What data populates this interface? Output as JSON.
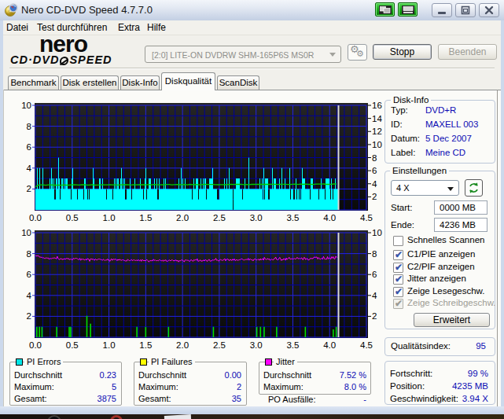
{
  "window": {
    "title": "Nero CD-DVD Speed 4.7.7.0",
    "app_icon": "gold-cd-with-gauge"
  },
  "menu": {
    "items": [
      "Datei",
      "Test durchführen",
      "Extra",
      "Hilfe"
    ]
  },
  "toolbar": {
    "logo_line1": "nero",
    "logo_line2_left": "CD·DVD",
    "logo_line2_right": "SPEED",
    "drive_select_value": "[2:0]   LITE-ON DVDRW SHM-165P6S MS0R",
    "eject_icon": "gears-icon",
    "stop_label": "Stopp",
    "exit_label": "Beenden"
  },
  "tabs": [
    {
      "label": "Benchmark",
      "active": false
    },
    {
      "label": "Disk erstellen",
      "active": false
    },
    {
      "label": "Disk-Info",
      "active": false
    },
    {
      "label": "Diskqualität",
      "active": true
    },
    {
      "label": "ScanDisk",
      "active": false
    }
  ],
  "disk_info": {
    "title": "Disk-Info",
    "rows": [
      {
        "label": "Typ:",
        "value": "DVD+R"
      },
      {
        "label": "ID:",
        "value": "MAXELL 003"
      },
      {
        "label": "Datum:",
        "value": "5 Dec 2007"
      },
      {
        "label": "Label:",
        "value": "Meine CD"
      }
    ]
  },
  "settings": {
    "title": "Einstellungen",
    "speed_value": "4 X",
    "start_label": "Start:",
    "start_value": "0000 MB",
    "end_label": "Ende:",
    "end_value": "4236 MB",
    "checkboxes": [
      {
        "label": "Schnelles Scannen",
        "checked": false,
        "disabled": false
      },
      {
        "label": "C1/PIE anzeigen",
        "checked": true,
        "disabled": false
      },
      {
        "label": "C2/PIF anzeigen",
        "checked": true,
        "disabled": false
      },
      {
        "label": "Jitter anzeigen",
        "checked": true,
        "disabled": false
      },
      {
        "label": "Zeige Lesegeschw.",
        "checked": true,
        "disabled": false
      },
      {
        "label": "Zeige Schreibgeschw.",
        "checked": true,
        "disabled": true
      }
    ],
    "advanced_label": "Erweitert"
  },
  "quality": {
    "label": "Qualitätsindex:",
    "value": "95"
  },
  "progress": {
    "rows": [
      {
        "label": "Fortschritt:",
        "value": "99 %"
      },
      {
        "label": "Position:",
        "value": "4235 MB"
      },
      {
        "label": "Geschwindigkeit:",
        "value": "3.94 X"
      }
    ]
  },
  "stats": {
    "pi_errors": {
      "title": "PI Errors",
      "legend_color": "#00e6e6",
      "rows": [
        {
          "label": "Durchschnitt",
          "value": "0.23"
        },
        {
          "label": "Maximum:",
          "value": "5"
        },
        {
          "label": "Gesamt:",
          "value": "3875"
        }
      ]
    },
    "pi_failures": {
      "title": "PI Failures",
      "legend_color": "#ffff00",
      "rows": [
        {
          "label": "Durchschnitt",
          "value": "0.00"
        },
        {
          "label": "Maximum:",
          "value": "2"
        },
        {
          "label": "Gesamt:",
          "value": "35"
        }
      ]
    },
    "jitter": {
      "title": "Jitter",
      "legend_color": "#ff00ff",
      "rows": [
        {
          "label": "Durchschnitt",
          "value": "7.52 %"
        },
        {
          "label": "Maximum:",
          "value": "8.0 %"
        }
      ]
    },
    "po_failures": {
      "label": "PO Ausfälle:",
      "value": "-"
    }
  },
  "chart_data": [
    {
      "type": "area",
      "title": "PI Errors histogram with read speed line",
      "xlim": [
        0,
        4.5
      ],
      "ylim_left": [
        0,
        10
      ],
      "ylim_right": [
        0,
        16
      ],
      "x_ticks": [
        "0.0",
        "0.5",
        "1.0",
        "1.5",
        "2.0",
        "2.5",
        "3.0",
        "3.5",
        "4.0",
        "4.5"
      ],
      "y_left_ticks": [
        10,
        8,
        6,
        4,
        2
      ],
      "y_right_ticks": [
        16,
        14,
        12,
        10,
        8,
        6,
        4,
        2
      ],
      "scan_end_gb": 4.105,
      "colors": {
        "area": "#00ffff",
        "speed_line": "#00cc00",
        "cursor": "#dadada",
        "grid_major": "#2323e4",
        "grid_minor": "#00009a"
      },
      "pi_error_columns": [
        2,
        2,
        4,
        2,
        2,
        4,
        2,
        2,
        2,
        4,
        2,
        2,
        2,
        2,
        2,
        2,
        2,
        2,
        3,
        2,
        4,
        3,
        2,
        3,
        1,
        1,
        3,
        3,
        2,
        5,
        3,
        1,
        2,
        3,
        3,
        2,
        3,
        2,
        3,
        3,
        3,
        2,
        2,
        2,
        2,
        1,
        3,
        4,
        2,
        2,
        2,
        2,
        2,
        1,
        2,
        2,
        2,
        2,
        2,
        2,
        2,
        1,
        3,
        3,
        2,
        2,
        1,
        2,
        1,
        2,
        2,
        2,
        2,
        4,
        3,
        2,
        2,
        2,
        2,
        2,
        2,
        3,
        3,
        2,
        2,
        3,
        2,
        2,
        2,
        2,
        1,
        2,
        2,
        2,
        2,
        2,
        2,
        2,
        1,
        2,
        3,
        2,
        3,
        2,
        3,
        3,
        2,
        2,
        3,
        4,
        2,
        3,
        2,
        3,
        1,
        1,
        2,
        2,
        2,
        2,
        3,
        2,
        1,
        2,
        2,
        2,
        3,
        2,
        2,
        2,
        2,
        2,
        2,
        3,
        2,
        2,
        2,
        1,
        2,
        3,
        4,
        1,
        2,
        2,
        3,
        3,
        3,
        2,
        2,
        2,
        2,
        3,
        2,
        2,
        3,
        1,
        1,
        3,
        2,
        2,
        2,
        2,
        2,
        3,
        2,
        3,
        2,
        2,
        2,
        2,
        2,
        2,
        2,
        2,
        2,
        2,
        2,
        2,
        2,
        2,
        2,
        2,
        3,
        2,
        2,
        4,
        2,
        3,
        2,
        2,
        3,
        2,
        2,
        2,
        2,
        2,
        2,
        2,
        2,
        1,
        2,
        3,
        2,
        2,
        3,
        3,
        3,
        1,
        2,
        2,
        3,
        2,
        2,
        3,
        2,
        3,
        3,
        1,
        2,
        2,
        2,
        3,
        3,
        3,
        3,
        4,
        2,
        2,
        2,
        2,
        2,
        1,
        1,
        1,
        2,
        2,
        2,
        2,
        2,
        2,
        3,
        2,
        2,
        3,
        2,
        2,
        4,
        2,
        2,
        2,
        2,
        0,
        2,
        2,
        2,
        3,
        3,
        3,
        3,
        3,
        2,
        2,
        2,
        1,
        2,
        2,
        3,
        2,
        2,
        2,
        2,
        5,
        2,
        2,
        2,
        2,
        2,
        2,
        2,
        2,
        2,
        2,
        2,
        2,
        2,
        3,
        2,
        2,
        3,
        1,
        4,
        1,
        3,
        3,
        3,
        3,
        1,
        1,
        2,
        2,
        2,
        4,
        2,
        3,
        3,
        3,
        2,
        2,
        2,
        2,
        3,
        2,
        2,
        4,
        2,
        2,
        2,
        3,
        2,
        2,
        2,
        2,
        2,
        4,
        1,
        2,
        2,
        2,
        1,
        1,
        2,
        3,
        1,
        2,
        2,
        1,
        2,
        1,
        2,
        4,
        3,
        3,
        3,
        2,
        2,
        2,
        2,
        2,
        2,
        1,
        3,
        3,
        3,
        2,
        2,
        2,
        2,
        2,
        2,
        2,
        1,
        2,
        2,
        3,
        2,
        2,
        2,
        2,
        1,
        3,
        3,
        3,
        3,
        3,
        2,
        1,
        3,
        2,
        1,
        2,
        2,
        3,
        2,
        2,
        2
      ],
      "speed_line": {
        "x0": 0,
        "dx": 0.035,
        "speed": [
          3.53,
          3.77,
          3.84,
          3.83,
          3.77,
          3.82,
          3.84,
          3.79,
          3.79,
          3.79,
          3.78,
          3.82,
          3.79,
          3.79,
          3.84,
          3.85,
          3.84,
          3.81,
          3.85,
          3.85,
          3.8,
          3.81,
          3.86,
          3.79,
          3.8,
          3.83,
          3.86,
          3.83,
          3.83,
          3.87,
          3.84,
          3.83,
          3.81,
          3.84,
          3.86,
          3.85,
          3.86,
          3.81,
          3.87,
          3.83,
          3.85,
          3.86,
          3.85,
          3.83,
          3.88,
          3.84,
          3.89,
          3.86,
          3.83,
          3.87,
          3.83,
          3.89,
          3.89,
          3.83,
          3.86,
          3.89,
          3.85,
          3.87,
          3.88,
          3.84,
          3.91,
          3.87,
          3.89,
          3.87,
          3.84,
          3.89,
          3.91,
          3.88,
          3.89,
          3.89,
          3.86,
          3.85,
          3.86,
          3.87,
          3.85,
          3.88,
          3.92,
          3.88,
          3.91,
          3.91,
          3.92,
          3.87,
          3.88,
          3.87,
          3.91,
          3.93,
          3.91,
          3.91,
          3.91,
          3.91,
          3.93,
          3.91,
          3.93,
          3.93,
          3.89,
          3.91,
          3.92,
          3.92,
          3.9,
          3.9,
          3.93,
          3.94,
          3.89,
          3.95,
          3.91,
          3.94,
          3.91,
          3.92,
          3.9,
          3.95,
          3.94,
          3.95,
          3.97,
          3.91,
          3.91,
          3.93,
          3.97,
          3.96
        ]
      }
    },
    {
      "type": "line+bar",
      "title": "Jitter line with PI Failures bars",
      "xlim": [
        0,
        4.5
      ],
      "ylim_left": [
        0,
        10
      ],
      "ylim_right": [
        0,
        10
      ],
      "x_ticks": [
        "0.0",
        "0.5",
        "1.0",
        "1.5",
        "2.0",
        "2.5",
        "3.0",
        "3.5",
        "4.0",
        "4.5"
      ],
      "y_left_ticks": [
        10,
        8,
        6,
        4,
        2
      ],
      "y_right_ticks": [
        10,
        8,
        6,
        4,
        2
      ],
      "scan_end_gb": 4.105,
      "colors": {
        "bars": "#00dc00",
        "jitter_line": "#ff00ff",
        "cursor": "#dadada",
        "grid_major": "#2323e4",
        "grid_minor": "#00009a"
      },
      "jitter_line": {
        "x0": 0,
        "dx": 0.011,
        "values": [
          7.8,
          7.8,
          7.75,
          7.82,
          7.79,
          7.67,
          7.67,
          7.64,
          7.66,
          7.58,
          7.61,
          7.56,
          7.52,
          7.61,
          7.57,
          7.57,
          7.59,
          7.44,
          7.54,
          7.53,
          7.52,
          7.59,
          7.51,
          7.62,
          7.57,
          7.56,
          7.5,
          7.74,
          7.56,
          7.46,
          7.43,
          7.51,
          7.53,
          7.42,
          7.48,
          7.44,
          7.53,
          7.46,
          7.52,
          7.56,
          7.49,
          7.55,
          7.41,
          7.47,
          7.46,
          7.44,
          7.4,
          7.56,
          7.5,
          7.54,
          7.55,
          7.55,
          7.5,
          7.44,
          7.43,
          7.55,
          7.35,
          7.5,
          7.43,
          7.51,
          7.4,
          7.39,
          7.47,
          7.37,
          7.51,
          7.5,
          7.47,
          7.26,
          7.47,
          7.51,
          7.42,
          7.49,
          7.43,
          7.35,
          7.49,
          7.42,
          7.38,
          7.44,
          7.47,
          7.48,
          7.45,
          7.43,
          7.41,
          7.35,
          7.46,
          7.39,
          7.34,
          7.39,
          7.37,
          7.49,
          7.37,
          7.43,
          7.26,
          7.39,
          7.51,
          7.35,
          7.46,
          7.46,
          7.43,
          7.47,
          7.43,
          7.32,
          7.45,
          7.36,
          7.46,
          7.4,
          7.37,
          7.35,
          7.43,
          7.37,
          7.35,
          7.3,
          7.3,
          7.29,
          7.46,
          7.38,
          7.33,
          7.33,
          7.38,
          7.43,
          7.31,
          7.39,
          7.39,
          7.35,
          7.34,
          7.38,
          7.29,
          7.43,
          7.34,
          7.31,
          7.42,
          7.26,
          7.42,
          7.38,
          7.29,
          7.37,
          7.3,
          7.39,
          7.42,
          7.34,
          7.2,
          7.27,
          7.34,
          7.3,
          7.36,
          7.3,
          7.46,
          7.34,
          7.4,
          7.32,
          7.32,
          7.34,
          7.31,
          7.41,
          7.38,
          7.34,
          7.3,
          7.38,
          7.26,
          7.38,
          7.31,
          7.41,
          7.27,
          7.27,
          7.3,
          7.36,
          7.38,
          7.29,
          7.37,
          7.42,
          7.34,
          7.31,
          7.33,
          7.36,
          7.38,
          7.28,
          7.36,
          7.2,
          7.33,
          7.3,
          7.37,
          7.39,
          7.38,
          7.28,
          7.22,
          7.38,
          7.4,
          7.36,
          7.36,
          7.36,
          7.27,
          7.27,
          7.4,
          7.4,
          7.3,
          7.27,
          7.42,
          7.36,
          7.43,
          7.36,
          7.51,
          7.27,
          7.29,
          7.33,
          7.4,
          7.26,
          7.31,
          7.3,
          7.4,
          7.29,
          7.41,
          7.39,
          7.26,
          7.29,
          7.42,
          7.43,
          7.27,
          7.31,
          7.29,
          7.41,
          7.37,
          7.39,
          7.41,
          7.56,
          7.35,
          7.39,
          7.3,
          7.29,
          7.41,
          7.43,
          7.38,
          7.35,
          7.36,
          7.44,
          7.53,
          7.31,
          7.44,
          7.45,
          7.48,
          7.35,
          7.34,
          7.45,
          7.36,
          7.35,
          7.47,
          7.36,
          7.49,
          7.33,
          7.36,
          7.44,
          7.34,
          7.38,
          7.41,
          7.4,
          7.49,
          7.49,
          7.46,
          7.4,
          7.38,
          7.41,
          7.43,
          7.44,
          7.4,
          7.55,
          7.36,
          7.47,
          7.47,
          7.39,
          7.43,
          7.3,
          7.44,
          7.47,
          7.47,
          7.39,
          7.4,
          7.47,
          7.42,
          7.36,
          7.52,
          7.38,
          7.48,
          7.51,
          7.37,
          7.64,
          7.5,
          7.42,
          7.45,
          7.54,
          7.43,
          7.51,
          7.36,
          7.42,
          7.46,
          7.41,
          7.39,
          7.52,
          7.53,
          7.67,
          7.44,
          7.41,
          7.4,
          7.53,
          7.64,
          7.48,
          7.34,
          7.45,
          7.38,
          7.52,
          7.49,
          7.36,
          7.58,
          7.43,
          7.51,
          7.6,
          7.63,
          7.46,
          7.49,
          7.51,
          7.48,
          7.49,
          7.54,
          7.48,
          7.49,
          7.61,
          7.62,
          7.49,
          7.57,
          7.49,
          7.53,
          7.61,
          7.44,
          7.41,
          7.64,
          7.6,
          7.43,
          7.5,
          7.54,
          7.39,
          7.4,
          7.45,
          7.57,
          7.51,
          7.54,
          7.51,
          7.64,
          7.66,
          7.64,
          7.66,
          7.67,
          7.47,
          7.62,
          7.56,
          7.44,
          7.52,
          7.56,
          7.46,
          7.72,
          7.58,
          7.44,
          7.48,
          7.45,
          7.71,
          7.49,
          7.58,
          7.57,
          7.46,
          7.7,
          7.56,
          7.71,
          7.52,
          7.47,
          7.74,
          7.68,
          7.65
        ]
      },
      "pif_bars": [
        [
          0.02,
          1
        ],
        [
          0.055,
          1
        ],
        [
          0.09,
          1
        ],
        [
          0.29,
          1
        ],
        [
          0.46,
          1
        ],
        [
          0.48,
          1
        ],
        [
          0.7,
          2.05
        ],
        [
          0.75,
          1.3
        ],
        [
          1.38,
          1
        ],
        [
          1.5,
          1
        ],
        [
          1.81,
          1
        ],
        [
          2.42,
          1
        ],
        [
          3.01,
          1
        ],
        [
          3.06,
          1
        ],
        [
          3.11,
          1
        ],
        [
          3.28,
          1
        ],
        [
          3.67,
          1
        ],
        [
          4.05,
          0.75
        ],
        [
          4.09,
          1
        ]
      ]
    }
  ]
}
